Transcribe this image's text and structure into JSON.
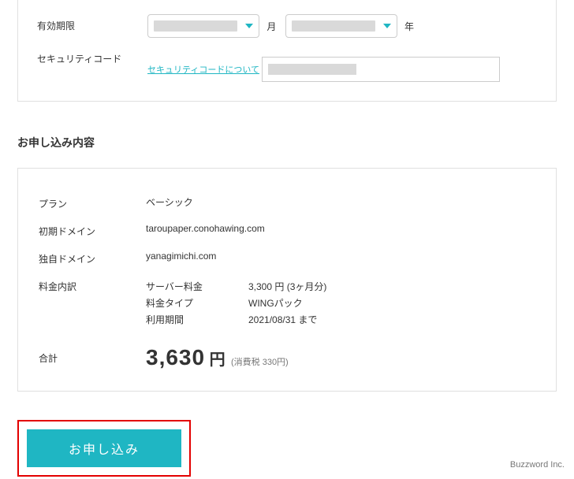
{
  "top_form": {
    "expiry_label": "有効期限",
    "month_suffix": "月",
    "year_suffix": "年",
    "security_label": "セキュリティコード",
    "security_help_link": "セキュリティコードについて",
    "security_value": ""
  },
  "summary_title": "お申し込み内容",
  "summary": {
    "plan_label": "プラン",
    "plan_value": "ベーシック",
    "initial_domain_label": "初期ドメイン",
    "initial_domain_value": "taroupaper.conohawing.com",
    "own_domain_label": "独自ドメイン",
    "own_domain_value": "yanagimichi.com",
    "breakdown_label": "料金内訳",
    "breakdown": {
      "server_fee_label": "サーバー料金",
      "server_fee_value": "3,300 円 (3ヶ月分)",
      "fee_type_label": "料金タイプ",
      "fee_type_value": "WINGパック",
      "period_label": "利用期間",
      "period_value": "2021/08/31 まで"
    },
    "total_label": "合計",
    "total_number": "3,630",
    "total_currency": " 円",
    "tax_note": "(消費税 330円)"
  },
  "apply_button_label": "お申し込み",
  "footer_credit": "Buzzword Inc."
}
